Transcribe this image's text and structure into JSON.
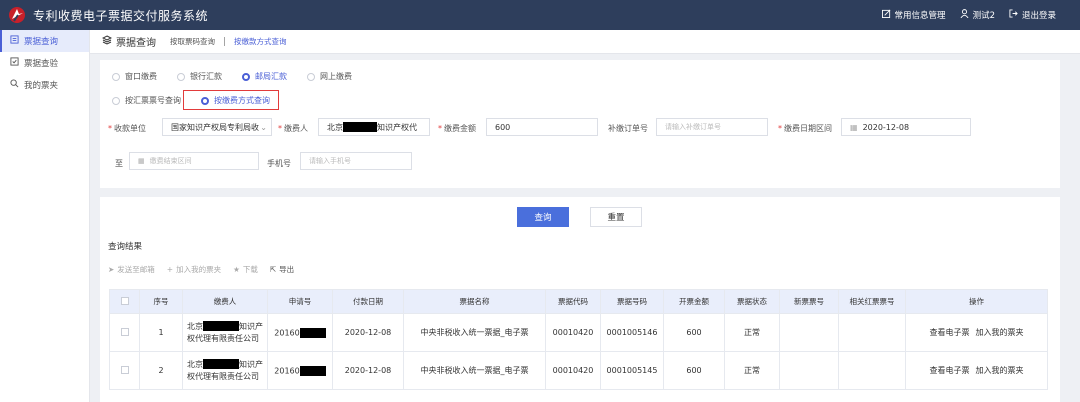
{
  "app": {
    "title": "专利收费电子票据交付服务系统"
  },
  "topbar": {
    "links": [
      "常用信息管理",
      "测试2",
      "退出登录"
    ]
  },
  "sidebar": {
    "items": [
      "票据查询",
      "票据查验",
      "我的票夹"
    ]
  },
  "tabs": {
    "head": "票据查询",
    "items": [
      "按取票码查询",
      "按缴款方式查询"
    ],
    "separator": "|"
  },
  "pay_methods": {
    "options": [
      "窗口缴费",
      "银行汇款",
      "邮局汇款",
      "网上缴费"
    ],
    "selected": 2
  },
  "query_modes": {
    "options": [
      "按汇票票号查询",
      "按缴费方式查询"
    ],
    "selected": 1
  },
  "form": {
    "unit_label": "收款单位",
    "unit_value": "国家知识产权局专利局收",
    "payer_label": "缴费人",
    "payer_prefix": "北京",
    "payer_suffix": "知识产权代",
    "amount_label": "缴费金额",
    "amount_value": "600",
    "order_label": "补缴订单号",
    "order_placeholder": "请输入补缴订单号",
    "date_label": "缴费日期区间",
    "date_start": "2020-12-08",
    "to_label": "至",
    "date_end_placeholder": "缴费结束区间",
    "phone_label": "手机号",
    "phone_placeholder": "请输入手机号"
  },
  "buttons": {
    "query": "查询",
    "reset": "重置"
  },
  "results": {
    "title": "查询结果",
    "actions": [
      "发送至邮箱",
      "加入我的票夹",
      "下载",
      "导出"
    ],
    "columns": [
      "序号",
      "缴费人",
      "申请号",
      "付款日期",
      "票据名称",
      "票据代码",
      "票据号码",
      "开票金额",
      "票据状态",
      "新票票号",
      "相关红票票号",
      "操作"
    ],
    "rows": [
      {
        "no": "1",
        "payer_a": "北京",
        "payer_b": "知识产",
        "payer_c": "权代理有限责任公司",
        "app_no": "20160",
        "date": "2020-12-08",
        "name": "中央非税收入统一票据_电子票",
        "code": "00010420",
        "number": "0001005146",
        "amount": "600",
        "status": "正常",
        "new_no": "",
        "red_no": ""
      },
      {
        "no": "2",
        "payer_a": "北京",
        "payer_b": "知识产",
        "payer_c": "权代理有限责任公司",
        "app_no": "20160",
        "date": "2020-12-08",
        "name": "中央非税收入统一票据_电子票",
        "code": "00010420",
        "number": "0001005145",
        "amount": "600",
        "status": "正常",
        "new_no": "",
        "red_no": ""
      }
    ],
    "row_ops": [
      "查看电子票",
      "加入我的票夹"
    ]
  },
  "colors": {
    "topbar": "#2e3e5c",
    "accent": "#4a5fd6",
    "primary_button": "#4a6fdc",
    "highlight": "#e23b3b"
  }
}
